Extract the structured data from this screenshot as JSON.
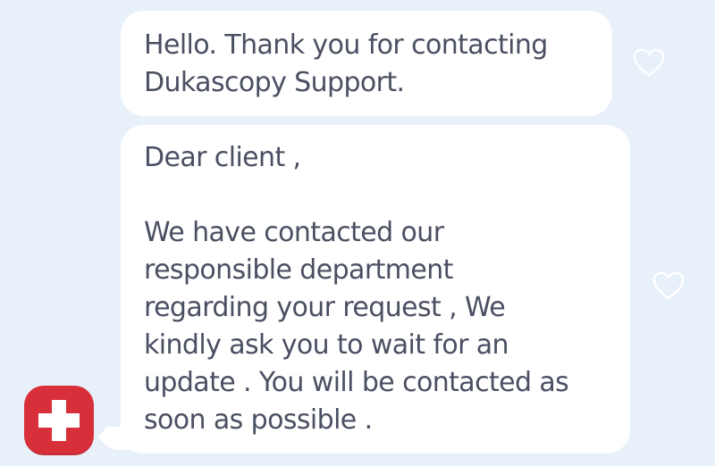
{
  "chat": {
    "messages": [
      {
        "lines": [
          "Hello. Thank you for contacting",
          "Dukascopy Support."
        ]
      },
      {
        "greeting": "Dear client ,",
        "lines": [
          "We have contacted our",
          "responsible department",
          "regarding your request , We",
          "kindly ask you to wait for an",
          "update . You will be contacted as",
          "soon as possible ."
        ]
      }
    ],
    "like_icon": "heart-outline-icon",
    "avatar_icon": "swiss-cross-icon"
  },
  "colors": {
    "background": "#e8f0fa",
    "bubble": "#ffffff",
    "text": "#4a4f62",
    "avatar": "#d8303a",
    "heart_outline": "#ffffff"
  }
}
